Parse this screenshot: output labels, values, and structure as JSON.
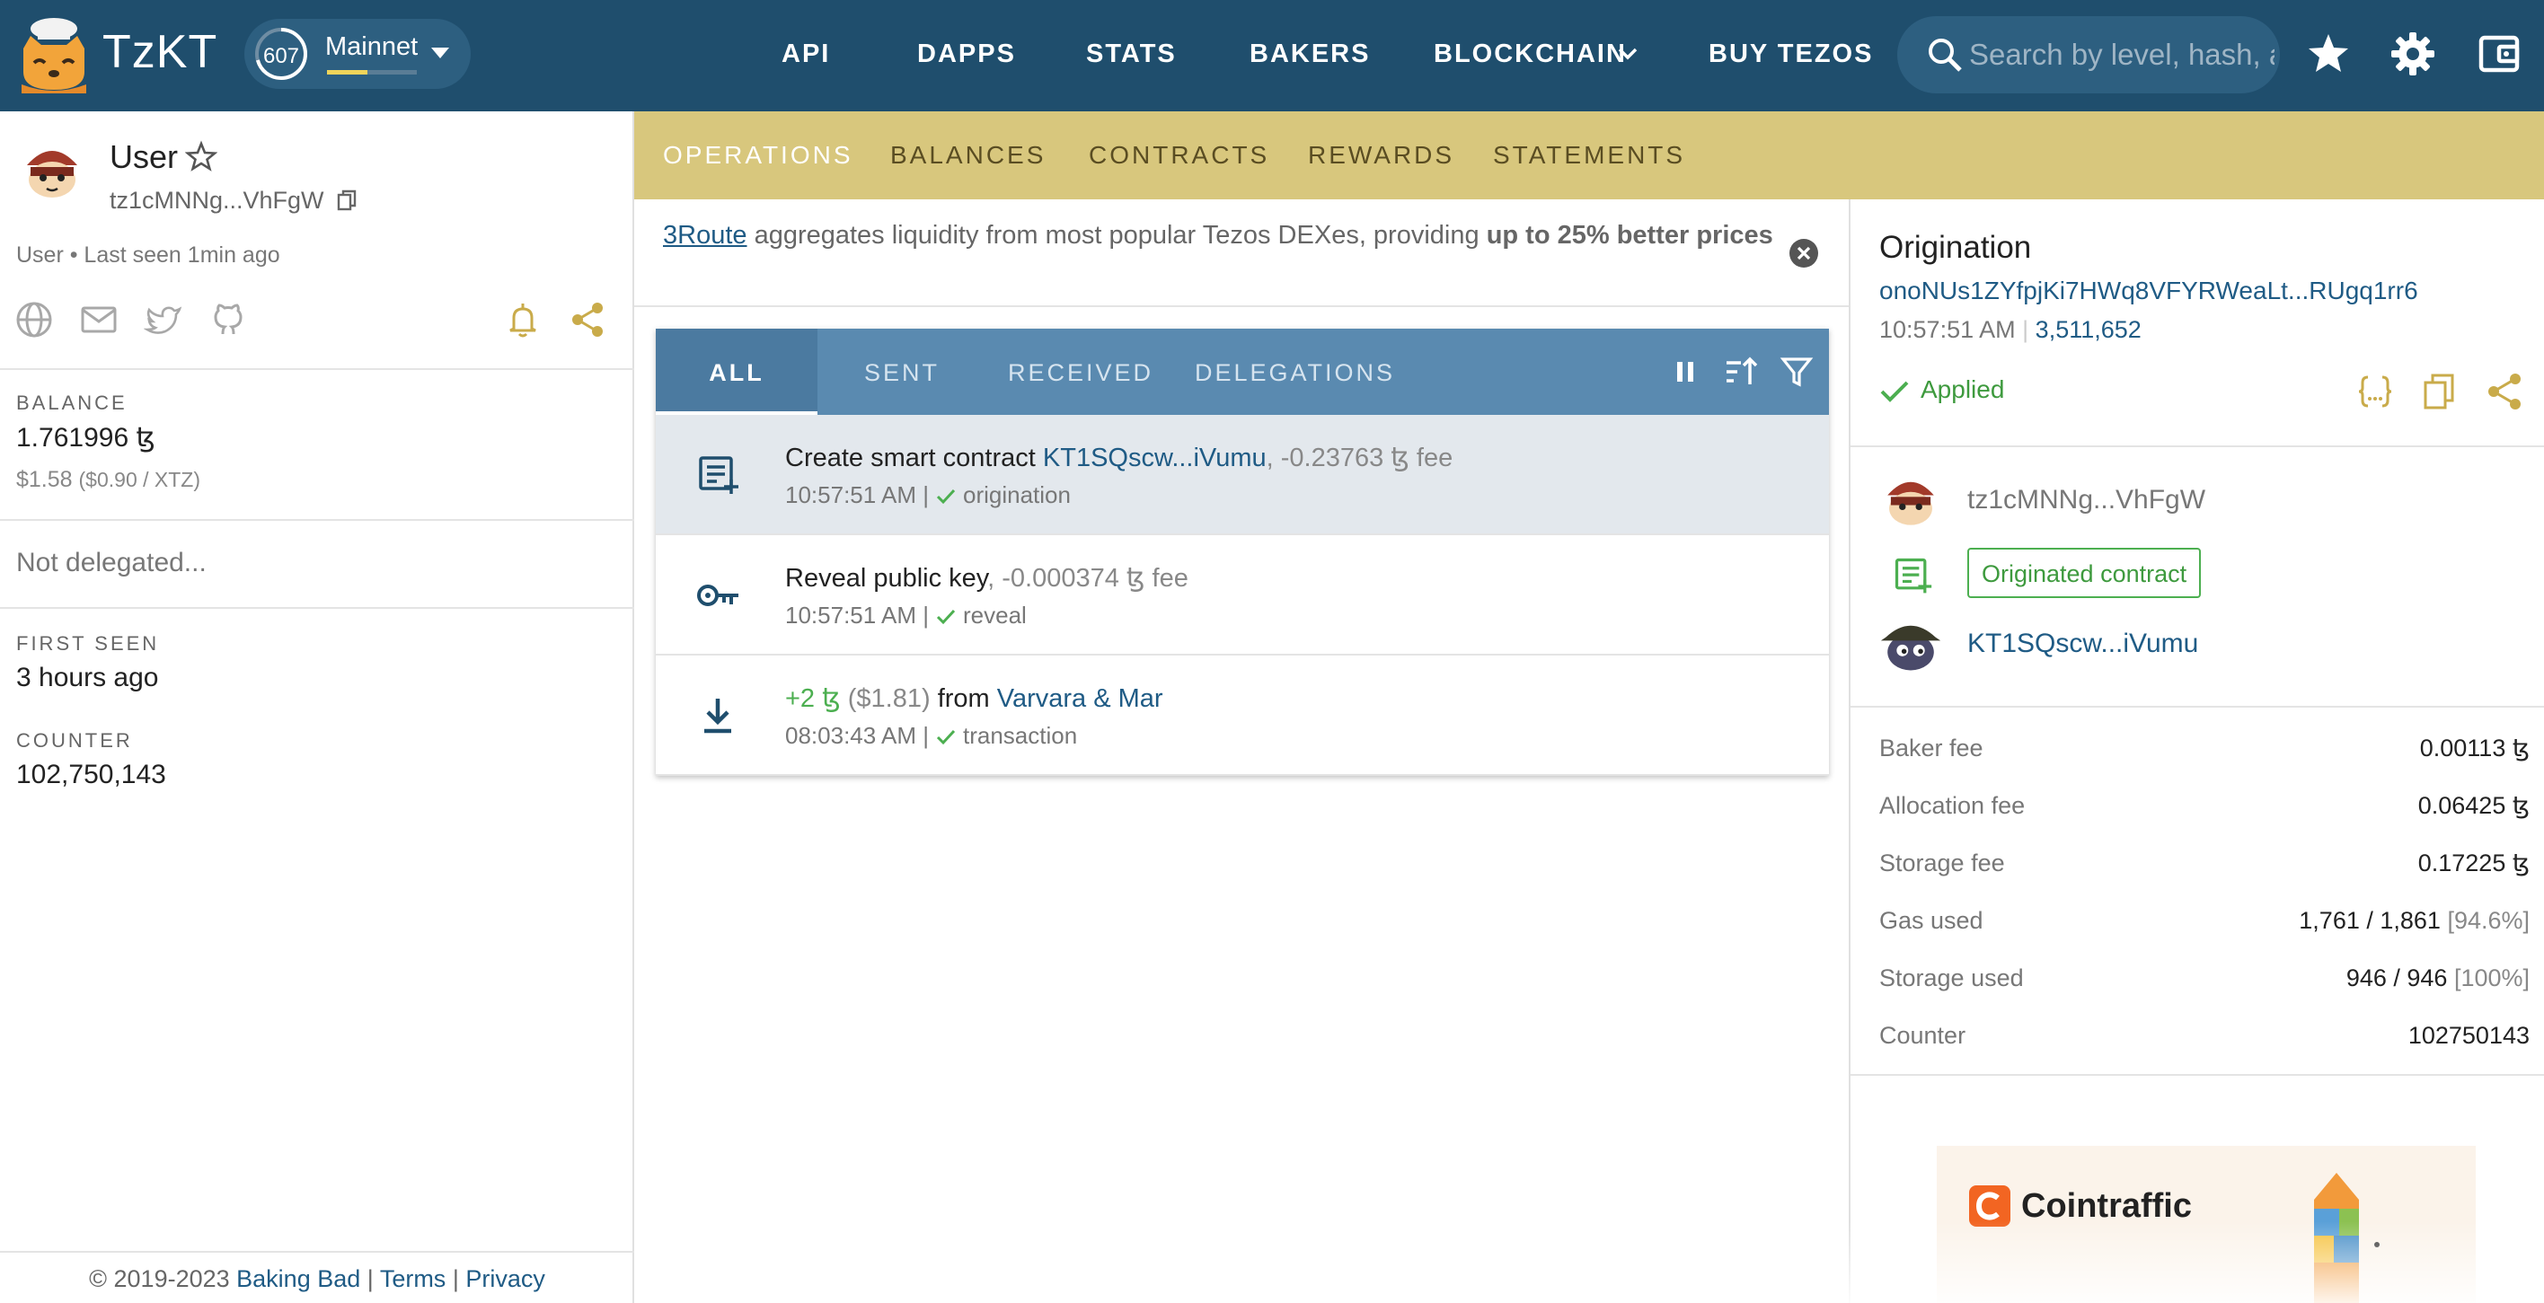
{
  "app": {
    "brand": "TzKT",
    "network": {
      "block_badge": "607",
      "name": "Mainnet",
      "progress": 0.45
    },
    "nav": [
      {
        "label": "API",
        "name": "nav-api"
      },
      {
        "label": "DAPPS",
        "name": "nav-dapps"
      },
      {
        "label": "STATS",
        "name": "nav-stats"
      },
      {
        "label": "BAKERS",
        "name": "nav-bakers"
      },
      {
        "label": "BLOCKCHAIN",
        "name": "nav-blockchain",
        "has_dropdown": true
      },
      {
        "label": "BUY TEZOS",
        "name": "nav-buy-tezos"
      }
    ],
    "search": {
      "placeholder": "Search by level, hash, al"
    },
    "icons": [
      "search-icon",
      "star-icon",
      "gear-icon",
      "wallet-icon"
    ],
    "colors": {
      "topbar": "#1f4e6d",
      "subbar": "#d8c77d",
      "link": "#1f5b85",
      "success": "#4caf50",
      "filterbar": "#5a8ab0"
    }
  },
  "account": {
    "name": "User",
    "address": "tz1cMNNg...VhFgW",
    "meta": "User • Last seen 1min ago",
    "social_icons": [
      "globe-icon",
      "mail-icon",
      "twitter-icon",
      "github-icon"
    ],
    "balance_label": "BALANCE",
    "balance": "1.761996 ꜩ",
    "balance_usd": "$1.58",
    "balance_rate": "($0.90 / XTZ)",
    "delegation": "Not delegated...",
    "first_seen_label": "FIRST SEEN",
    "first_seen": "3 hours ago",
    "counter_label": "COUNTER",
    "counter": "102,750,143"
  },
  "footer": {
    "copyright": "© 2019-2023",
    "baking_bad": "Baking Bad",
    "sep": "|",
    "terms": "Terms",
    "privacy": "Privacy"
  },
  "subtabs": [
    "OPERATIONS",
    "BALANCES",
    "CONTRACTS",
    "REWARDS",
    "STATEMENTS"
  ],
  "promo": {
    "link": "3Route",
    "text": " aggregates liquidity from most popular Tezos DEXes, providing ",
    "bold": "up to 25% better prices"
  },
  "filters": [
    "ALL",
    "SENT",
    "RECEIVED",
    "DELEGATIONS"
  ],
  "operations": [
    {
      "title": "Create smart contract",
      "link": "KT1SQscw...iVumu",
      "amount": ", -0.23763 ꜩ fee",
      "time": "10:57:51 AM |",
      "status": "origination"
    },
    {
      "title": "Reveal public key",
      "amount": ", -0.000374 ꜩ fee",
      "time": "10:57:51 AM |",
      "status": "reveal"
    },
    {
      "amount_green": "+2 ꜩ",
      "usd": " ($1.81) ",
      "from": "from ",
      "link": "Varvara & Mar",
      "time": "08:03:43 AM |",
      "status": "transaction"
    }
  ],
  "detail": {
    "title": "Origination",
    "hash": "onoNUs1ZYfpjKi7HWq8VFYRWeaLt...RUgq1rr6",
    "time": "10:57:51 AM",
    "block": "3,511,652",
    "status": "Applied",
    "sender": "tz1cMNNg...VhFgW",
    "originated_badge": "Originated contract",
    "contract": "KT1SQscw...iVumu",
    "fees": [
      {
        "k": "Baker fee",
        "v": "0.00113 ꜩ"
      },
      {
        "k": "Allocation fee",
        "v": "0.06425 ꜩ"
      },
      {
        "k": "Storage fee",
        "v": "0.17225 ꜩ"
      },
      {
        "k": "Gas used",
        "v": "1,761 / 1,861",
        "extra": "[94.6%]"
      },
      {
        "k": "Storage used",
        "v": "946 / 946",
        "extra": "[100%]"
      },
      {
        "k": "Counter",
        "v": "102750143"
      }
    ]
  },
  "ad": {
    "brand": "Cointraffic"
  }
}
